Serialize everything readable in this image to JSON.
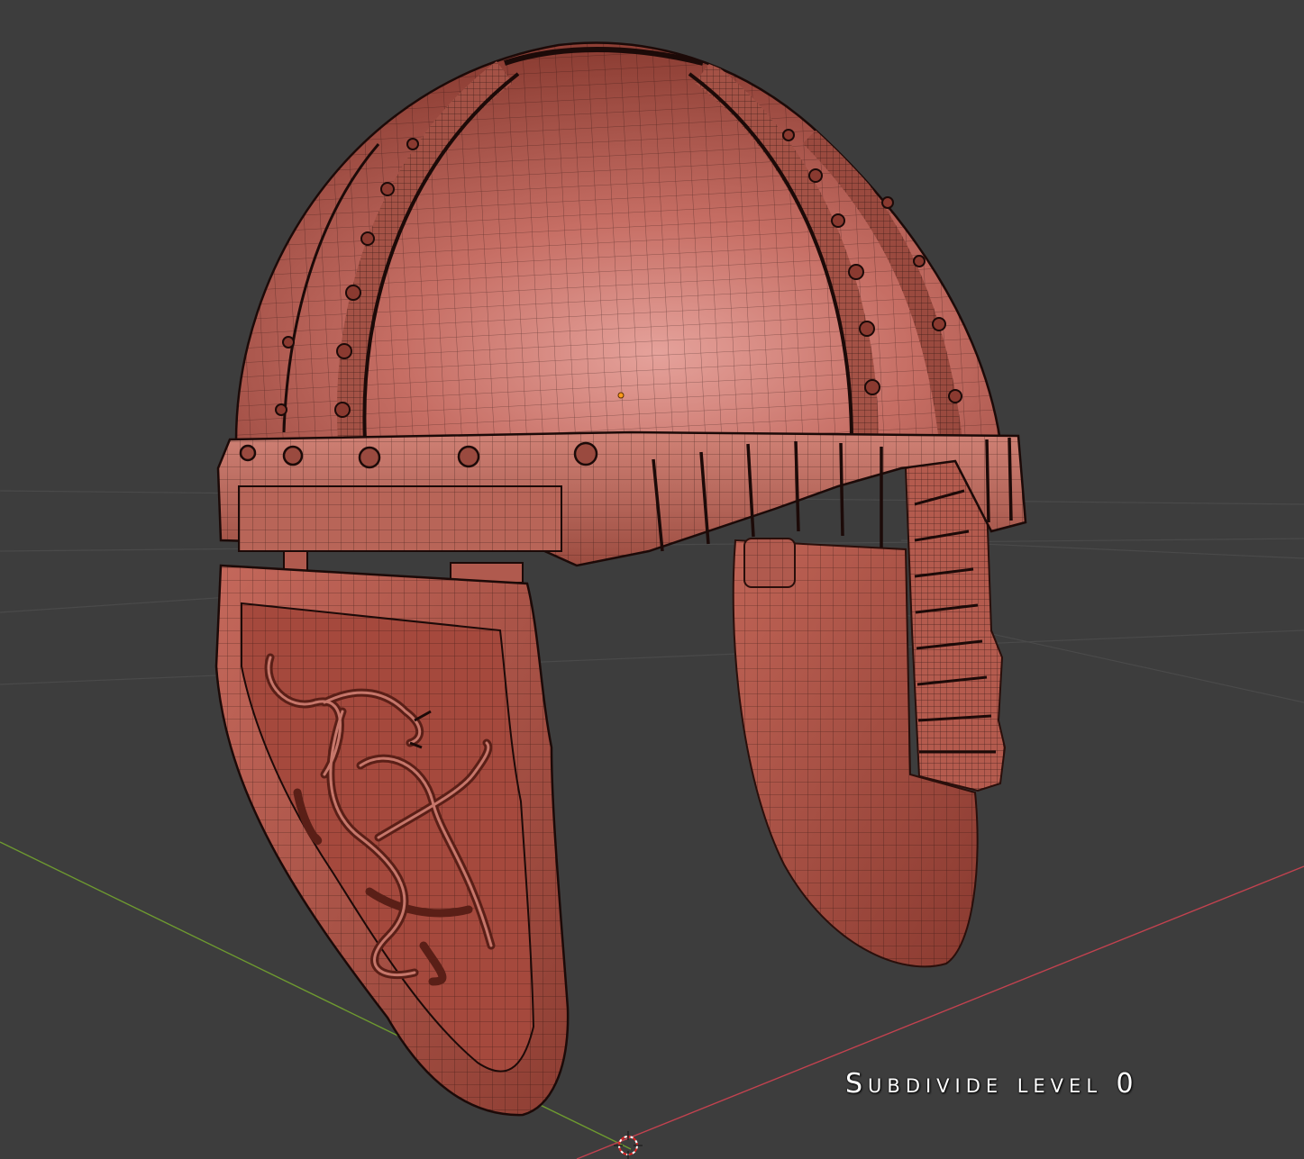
{
  "viewport": {
    "background": "#3d3d3d",
    "grid_color": "#4a4a4a",
    "x_axis_color": "#c2424f",
    "y_axis_color": "#6e9a30",
    "mesh_color": "#b65a4c",
    "mesh_highlight": "#d98f86",
    "wire_color": "#1c0a08",
    "origin_marker": "3d-cursor-icon"
  },
  "overlay": {
    "caption": "Subdivide level 0"
  }
}
